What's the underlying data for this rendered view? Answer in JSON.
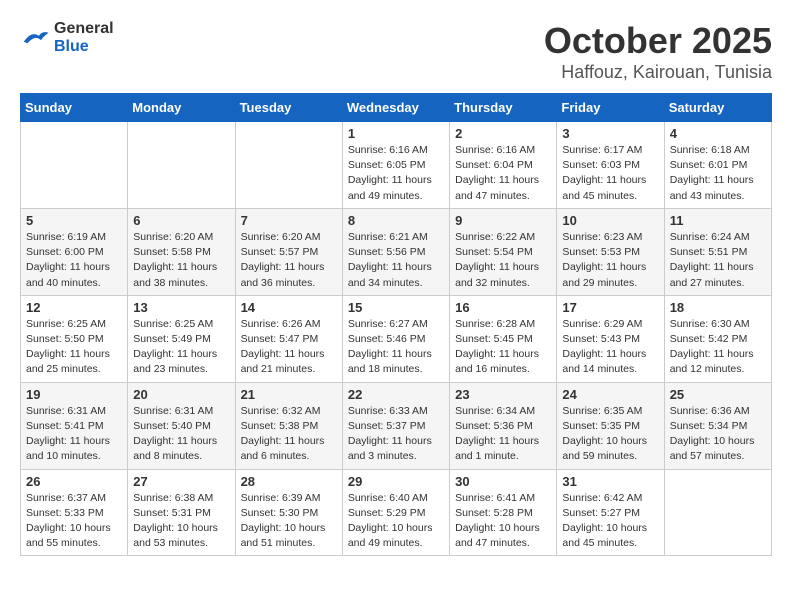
{
  "header": {
    "logo_general": "General",
    "logo_blue": "Blue",
    "month": "October 2025",
    "location": "Haffouz, Kairouan, Tunisia"
  },
  "calendar": {
    "weekdays": [
      "Sunday",
      "Monday",
      "Tuesday",
      "Wednesday",
      "Thursday",
      "Friday",
      "Saturday"
    ],
    "weeks": [
      [
        {
          "day": "",
          "info": ""
        },
        {
          "day": "",
          "info": ""
        },
        {
          "day": "",
          "info": ""
        },
        {
          "day": "1",
          "info": "Sunrise: 6:16 AM\nSunset: 6:05 PM\nDaylight: 11 hours\nand 49 minutes."
        },
        {
          "day": "2",
          "info": "Sunrise: 6:16 AM\nSunset: 6:04 PM\nDaylight: 11 hours\nand 47 minutes."
        },
        {
          "day": "3",
          "info": "Sunrise: 6:17 AM\nSunset: 6:03 PM\nDaylight: 11 hours\nand 45 minutes."
        },
        {
          "day": "4",
          "info": "Sunrise: 6:18 AM\nSunset: 6:01 PM\nDaylight: 11 hours\nand 43 minutes."
        }
      ],
      [
        {
          "day": "5",
          "info": "Sunrise: 6:19 AM\nSunset: 6:00 PM\nDaylight: 11 hours\nand 40 minutes."
        },
        {
          "day": "6",
          "info": "Sunrise: 6:20 AM\nSunset: 5:58 PM\nDaylight: 11 hours\nand 38 minutes."
        },
        {
          "day": "7",
          "info": "Sunrise: 6:20 AM\nSunset: 5:57 PM\nDaylight: 11 hours\nand 36 minutes."
        },
        {
          "day": "8",
          "info": "Sunrise: 6:21 AM\nSunset: 5:56 PM\nDaylight: 11 hours\nand 34 minutes."
        },
        {
          "day": "9",
          "info": "Sunrise: 6:22 AM\nSunset: 5:54 PM\nDaylight: 11 hours\nand 32 minutes."
        },
        {
          "day": "10",
          "info": "Sunrise: 6:23 AM\nSunset: 5:53 PM\nDaylight: 11 hours\nand 29 minutes."
        },
        {
          "day": "11",
          "info": "Sunrise: 6:24 AM\nSunset: 5:51 PM\nDaylight: 11 hours\nand 27 minutes."
        }
      ],
      [
        {
          "day": "12",
          "info": "Sunrise: 6:25 AM\nSunset: 5:50 PM\nDaylight: 11 hours\nand 25 minutes."
        },
        {
          "day": "13",
          "info": "Sunrise: 6:25 AM\nSunset: 5:49 PM\nDaylight: 11 hours\nand 23 minutes."
        },
        {
          "day": "14",
          "info": "Sunrise: 6:26 AM\nSunset: 5:47 PM\nDaylight: 11 hours\nand 21 minutes."
        },
        {
          "day": "15",
          "info": "Sunrise: 6:27 AM\nSunset: 5:46 PM\nDaylight: 11 hours\nand 18 minutes."
        },
        {
          "day": "16",
          "info": "Sunrise: 6:28 AM\nSunset: 5:45 PM\nDaylight: 11 hours\nand 16 minutes."
        },
        {
          "day": "17",
          "info": "Sunrise: 6:29 AM\nSunset: 5:43 PM\nDaylight: 11 hours\nand 14 minutes."
        },
        {
          "day": "18",
          "info": "Sunrise: 6:30 AM\nSunset: 5:42 PM\nDaylight: 11 hours\nand 12 minutes."
        }
      ],
      [
        {
          "day": "19",
          "info": "Sunrise: 6:31 AM\nSunset: 5:41 PM\nDaylight: 11 hours\nand 10 minutes."
        },
        {
          "day": "20",
          "info": "Sunrise: 6:31 AM\nSunset: 5:40 PM\nDaylight: 11 hours\nand 8 minutes."
        },
        {
          "day": "21",
          "info": "Sunrise: 6:32 AM\nSunset: 5:38 PM\nDaylight: 11 hours\nand 6 minutes."
        },
        {
          "day": "22",
          "info": "Sunrise: 6:33 AM\nSunset: 5:37 PM\nDaylight: 11 hours\nand 3 minutes."
        },
        {
          "day": "23",
          "info": "Sunrise: 6:34 AM\nSunset: 5:36 PM\nDaylight: 11 hours\nand 1 minute."
        },
        {
          "day": "24",
          "info": "Sunrise: 6:35 AM\nSunset: 5:35 PM\nDaylight: 10 hours\nand 59 minutes."
        },
        {
          "day": "25",
          "info": "Sunrise: 6:36 AM\nSunset: 5:34 PM\nDaylight: 10 hours\nand 57 minutes."
        }
      ],
      [
        {
          "day": "26",
          "info": "Sunrise: 6:37 AM\nSunset: 5:33 PM\nDaylight: 10 hours\nand 55 minutes."
        },
        {
          "day": "27",
          "info": "Sunrise: 6:38 AM\nSunset: 5:31 PM\nDaylight: 10 hours\nand 53 minutes."
        },
        {
          "day": "28",
          "info": "Sunrise: 6:39 AM\nSunset: 5:30 PM\nDaylight: 10 hours\nand 51 minutes."
        },
        {
          "day": "29",
          "info": "Sunrise: 6:40 AM\nSunset: 5:29 PM\nDaylight: 10 hours\nand 49 minutes."
        },
        {
          "day": "30",
          "info": "Sunrise: 6:41 AM\nSunset: 5:28 PM\nDaylight: 10 hours\nand 47 minutes."
        },
        {
          "day": "31",
          "info": "Sunrise: 6:42 AM\nSunset: 5:27 PM\nDaylight: 10 hours\nand 45 minutes."
        },
        {
          "day": "",
          "info": ""
        }
      ]
    ]
  }
}
